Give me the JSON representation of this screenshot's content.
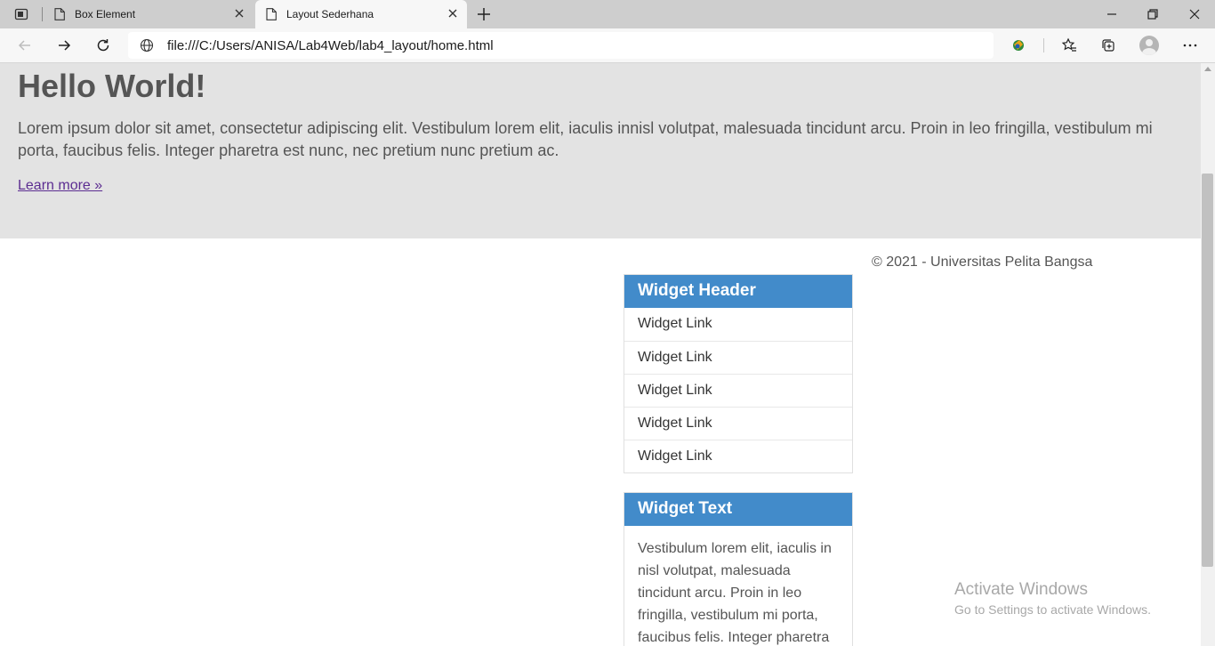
{
  "browser": {
    "tabs": [
      {
        "title": "Box Element",
        "active": false
      },
      {
        "title": "Layout Sederhana",
        "active": true
      }
    ],
    "address": "file:///C:/Users/ANISA/Lab4Web/lab4_layout/home.html"
  },
  "hero": {
    "title": "Hello World!",
    "paragraph": "Lorem ipsum dolor sit amet, consectetur adipiscing elit. Vestibulum lorem elit, iaculis innisl volutpat, malesuada tincidunt arcu. Proin in leo fringilla, vestibulum mi porta, faucibus felis. Integer pharetra est nunc, nec pretium nunc pretium ac.",
    "link": "Learn more »"
  },
  "widget_links": {
    "header": "Widget Header",
    "links": [
      "Widget Link",
      "Widget Link",
      "Widget Link",
      "Widget Link",
      "Widget Link"
    ]
  },
  "widget_text": {
    "header": "Widget Text",
    "body": "Vestibulum lorem elit, iaculis in nisl volutpat, malesuada tincidunt arcu. Proin in leo fringilla, vestibulum mi porta, faucibus felis. Integer pharetra"
  },
  "footer": {
    "copyright": "© 2021 - Universitas Pelita Bangsa"
  },
  "watermark": {
    "title": "Activate Windows",
    "subtitle": "Go to Settings to activate Windows."
  },
  "colors": {
    "widget_header": "#428bca",
    "hero_background": "#e3e3e3",
    "link": "#5c2d91"
  }
}
